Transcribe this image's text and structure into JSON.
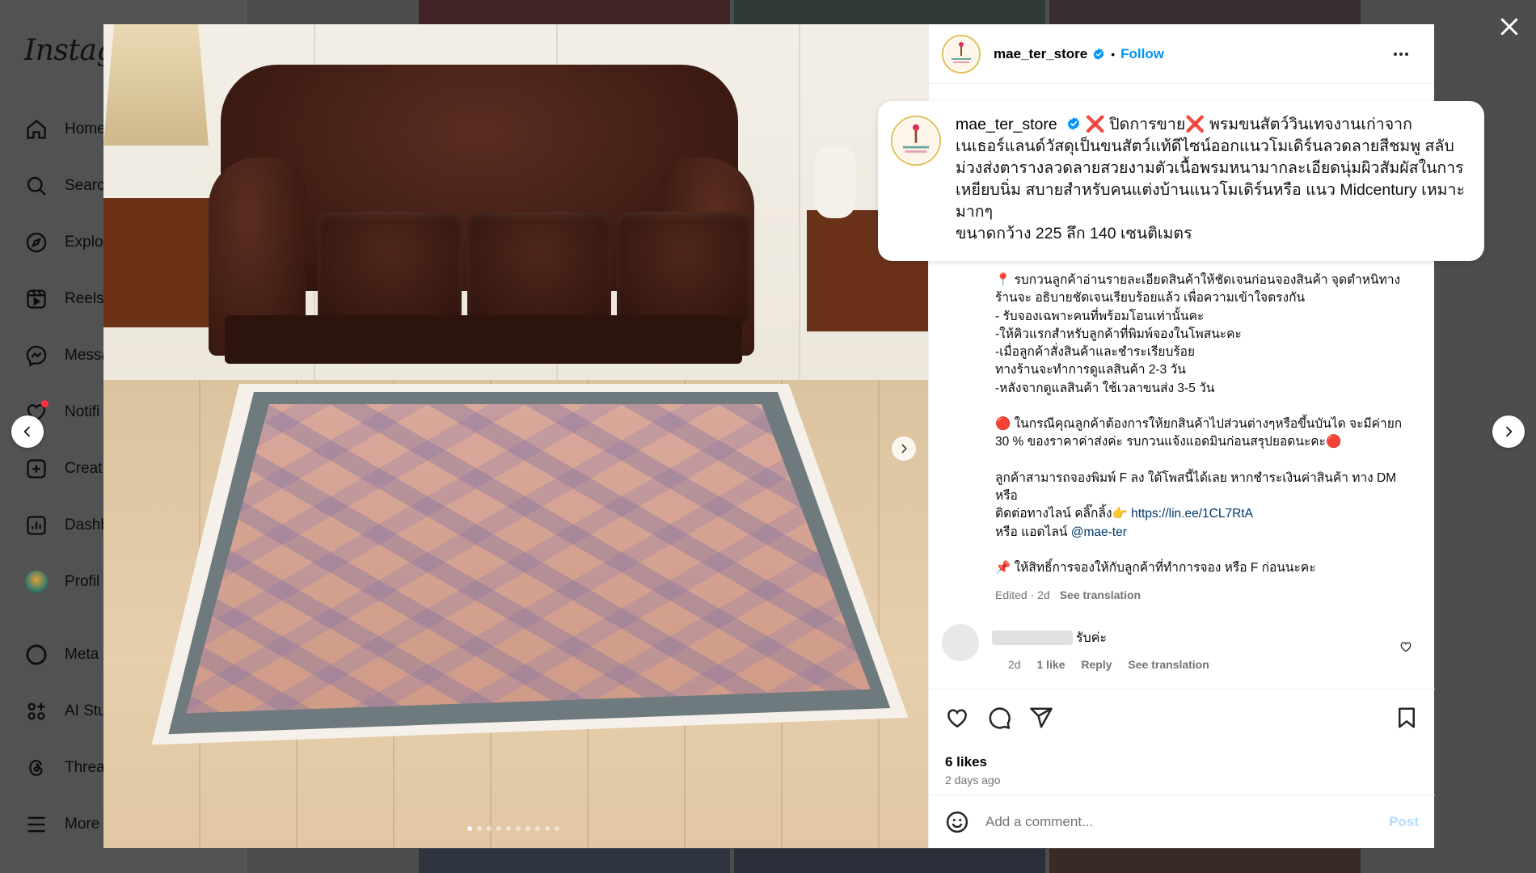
{
  "background": {
    "logo": "Instagra",
    "nav": [
      {
        "label": "Home",
        "icon": "home-icon"
      },
      {
        "label": "Searc",
        "icon": "search-icon"
      },
      {
        "label": "Explo",
        "icon": "explore-icon"
      },
      {
        "label": "Reels",
        "icon": "reels-icon"
      },
      {
        "label": "Messa",
        "icon": "messenger-icon"
      },
      {
        "label": "Notifi",
        "icon": "heart-icon"
      },
      {
        "label": "Creat",
        "icon": "plus-icon"
      },
      {
        "label": "Dashb",
        "icon": "dashboard-icon"
      },
      {
        "label": "Profil",
        "icon": "profile-avatar"
      },
      {
        "label": "Meta",
        "icon": "meta-icon"
      },
      {
        "label": "AI Stu",
        "icon": "ai-studio-icon"
      },
      {
        "label": "Threa",
        "icon": "threads-icon"
      },
      {
        "label": "More",
        "icon": "menu-icon"
      }
    ]
  },
  "post": {
    "username": "mae_ter_store",
    "separator": "•",
    "follow_label": "Follow",
    "caption_head": "❌ ปิดการขาย❌ พรมขนสัตว์วินเทจงานเก่าจากเนเธอร์แลนด์วัสดุเป็นขนสัตว์แท้ดีไซน์ออกแนวโมเดิร์นลวดลายสีชมพู สลับม่วงส่งตารางลวดลายสวยงามตัวเนื้อพรมหนามากละเอียดนุ่มผิวสัมผัสในการเหยียบนิ่ม สบายสำหรับคนแต่งบ้านแนวโมเดิร์นหรือ แนว Midcentury เหมาะมากๆ",
    "caption_size": "ขนาดกว้าง 225 ลึก 140 เซนติเมตร",
    "desc_lines": [
      "📍 รบกวนลูกค้าอ่านรายละเอียดสินค้าให้ชัดเจนก่อนจองสินค้า จุดตำหนิทางร้านจะ อธิบายชัดเจนเรียบร้อยแล้ว เพื่อความเข้าใจตรงกัน",
      "- รับจองเฉพาะคนที่พร้อมโอนเท่านั้นคะ",
      "-ให้คิวแรกสำหรับลูกค้าที่พิมพ์จองในโพสนะคะ",
      "-เมื่อลูกค้าสั่งสินค้าและชำระเรียบร้อย",
      "ทางร้านจะทำการดูแลสินค้า 2-3 วัน",
      "-หลังจากดูแลสินค้า ใช้เวลาขนส่ง 3-5 วัน",
      "",
      "🔴 ในกรณีคุณลูกค้าต้องการให้ยกสินค้าไปส่วนต่างๆหรือขึ้นบันได จะมีค่ายก 30 % ของราคาค่าส่งค่ะ รบกวนแจ้งแอดมินก่อนสรุปยอดนะคะ🔴",
      "",
      "ลูกค้าสามารถจองพิมพ์ F ลง ใต้โพสนี้ได้เลย หากชำระเงินค่าสินค้า ทาง DM หรือ"
    ],
    "contact_line_prefix": "ติดต่อทางไลน์ คลิ๊กลิ้ง👉 ",
    "contact_link": "https://lin.ee/1CL7RtA",
    "admin_line_prefix": "หรือ แอดไลน์ ",
    "admin_mention": "@mae-ter",
    "rights_line": "📌 ให้สิทธิ์การจองให้กับลูกค้าที่ทำการจอง หรือ F ก่อนนะคะ",
    "edited": "Edited · 2d",
    "see_translation": "See translation"
  },
  "comment": {
    "text": "รับค่ะ",
    "time": "2d",
    "likes": "1 like",
    "reply": "Reply",
    "see_translation": "See translation"
  },
  "stats": {
    "likes": "6 likes",
    "ago": "2 days ago"
  },
  "add_comment": {
    "placeholder": "Add a comment...",
    "post_label": "Post"
  },
  "carousel": {
    "total": 10,
    "active": 1
  },
  "colors": {
    "accent": "#0095f6",
    "post_disabled": "#b3dbff",
    "notification_dot": "#ff3040"
  }
}
